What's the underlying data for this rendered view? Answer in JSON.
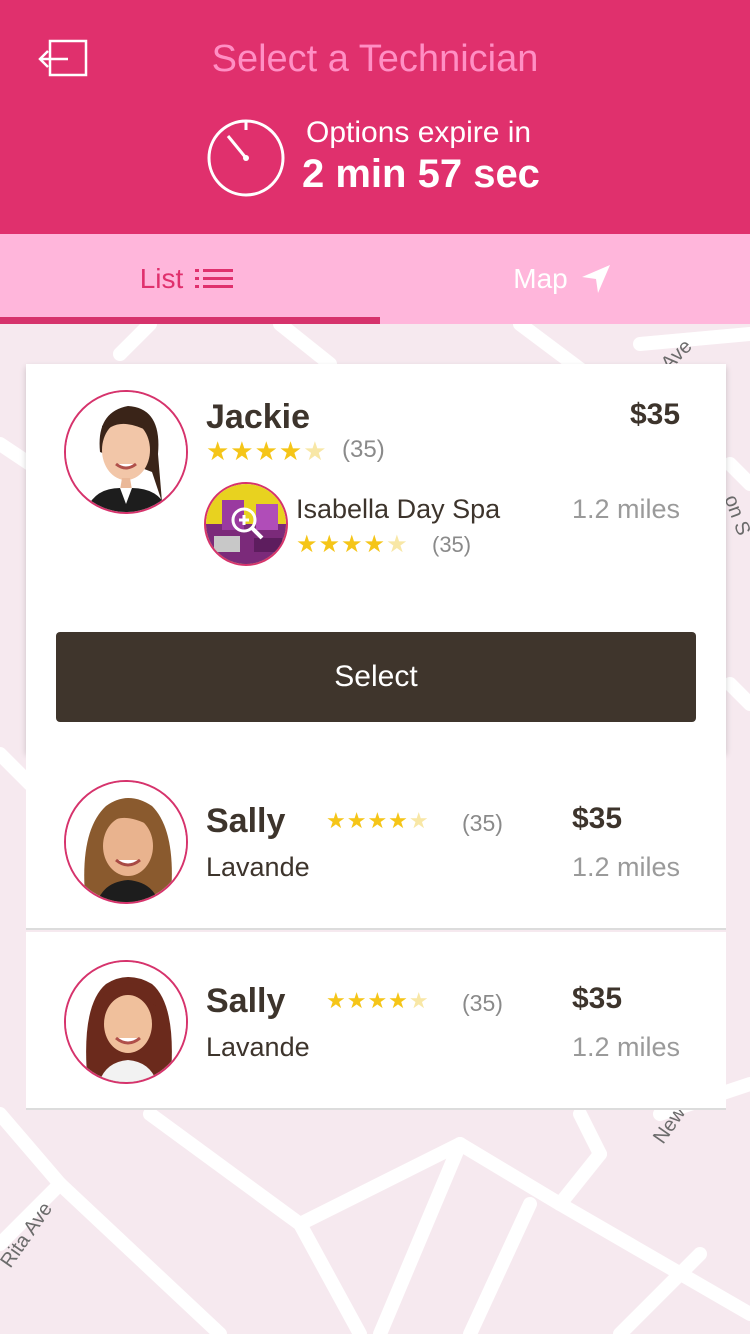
{
  "header": {
    "title": "Select a Technician",
    "expire_label": "Options expire in",
    "expire_value": "2 min 57 sec"
  },
  "tabs": {
    "list_label": "List",
    "map_label": "Map",
    "active": "List"
  },
  "map": {
    "street_labels": [
      "Ave",
      "on S",
      "Rita Ave",
      "New"
    ]
  },
  "technicians": [
    {
      "name": "Jackie",
      "price": "$35",
      "rating_stars": 4,
      "review_count": "(35)",
      "salon": {
        "name": "Isabella Day Spa",
        "rating_stars": 4,
        "review_count": "(35)",
        "distance": "1.2 miles"
      },
      "select_label": "Select"
    },
    {
      "name": "Sally",
      "price": "$35",
      "rating_stars": 4,
      "review_count": "(35)",
      "salon_name": "Lavande",
      "distance": "1.2 miles"
    },
    {
      "name": "Sally",
      "price": "$35",
      "rating_stars": 4,
      "review_count": "(35)",
      "salon_name": "Lavande",
      "distance": "1.2 miles"
    }
  ],
  "colors": {
    "brand_pink": "#e0306d",
    "tab_bar": "#ffb6db",
    "title_pink": "#ff8fc4",
    "dark_brown": "#3f352c",
    "star_gold": "#f5c518"
  }
}
